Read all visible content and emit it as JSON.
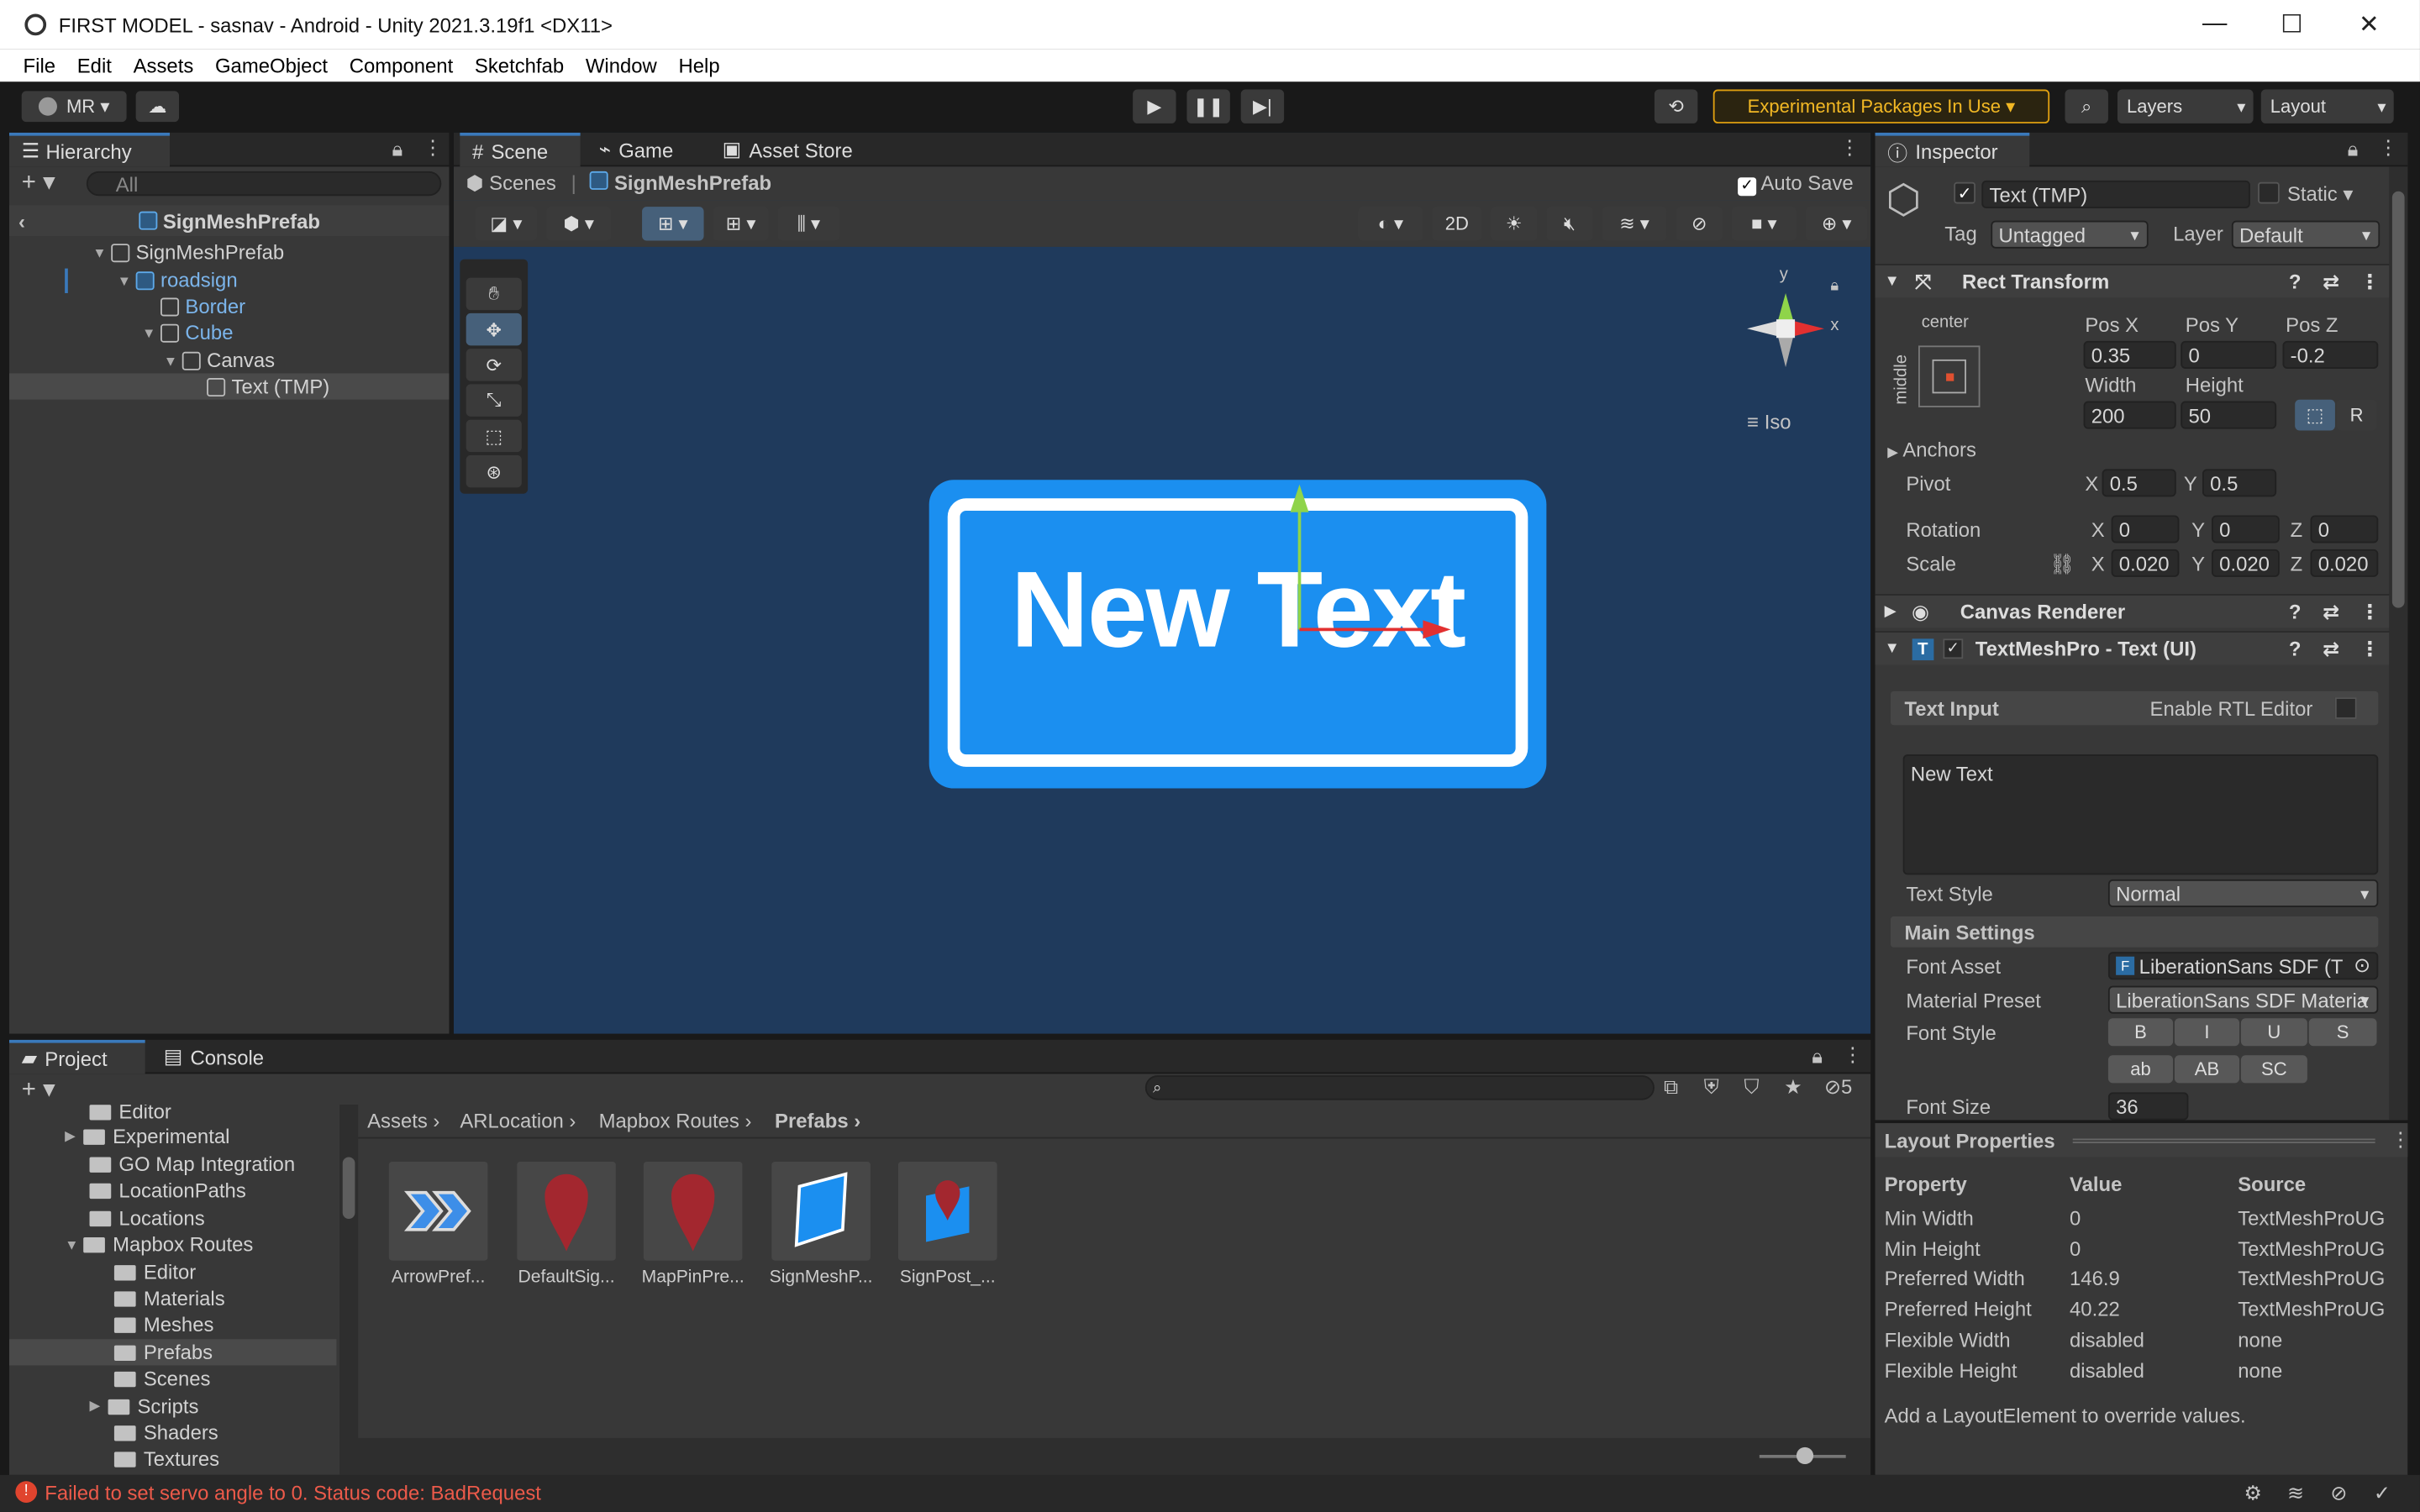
{
  "window": {
    "title": "FIRST MODEL - sasnav - Android - Unity 2021.3.19f1 <DX11>"
  },
  "menu": [
    "File",
    "Edit",
    "Assets",
    "GameObject",
    "Component",
    "Sketchfab",
    "Window",
    "Help"
  ],
  "toolbar": {
    "account": "MR",
    "experimental": "Experimental Packages In Use",
    "layers": "Layers",
    "layout": "Layout"
  },
  "hierarchy": {
    "tab": "Hierarchy",
    "search_placeholder": "All",
    "root": "SignMeshPrefab",
    "items": [
      "SignMeshPrefab",
      "roadsign",
      "Border",
      "Cube",
      "Canvas",
      "Text (TMP)"
    ]
  },
  "scene": {
    "tabs": [
      "Scene",
      "Game",
      "Asset Store"
    ],
    "breadcrumb": [
      "Scenes",
      "SignMeshPrefab"
    ],
    "auto_save": "Auto Save",
    "mode_2d": "2D",
    "iso": "Iso",
    "gizmo_y": "y",
    "gizmo_x": "x",
    "sign_text": "New Text"
  },
  "project": {
    "tabs": [
      "Project",
      "Console"
    ],
    "badge": "5",
    "folders": [
      "Editor",
      "Experimental",
      "GO Map Integration",
      "LocationPaths",
      "Locations",
      "Mapbox Routes",
      "Editor",
      "Materials",
      "Meshes",
      "Prefabs",
      "Scenes",
      "Scripts",
      "Shaders",
      "Textures"
    ],
    "path": [
      "Assets",
      "ARLocation",
      "Mapbox Routes",
      "Prefabs"
    ],
    "assets": [
      "ArrowPref...",
      "DefaultSig...",
      "MapPinPre...",
      "SignMeshP...",
      "SignPost_..."
    ]
  },
  "inspector": {
    "tab": "Inspector",
    "object_name": "Text (TMP)",
    "static_label": "Static",
    "tag_label": "Tag",
    "tag": "Untagged",
    "layer_label": "Layer",
    "layer": "Default",
    "rect": {
      "title": "Rect Transform",
      "anchor_h": "center",
      "anchor_v": "middle",
      "posx_l": "Pos X",
      "posy_l": "Pos Y",
      "posz_l": "Pos Z",
      "posx": "0.35",
      "posy": "0",
      "posz": "-0.2",
      "w_l": "Width",
      "h_l": "Height",
      "w": "200",
      "h": "50",
      "r": "R",
      "anchors": "Anchors",
      "pivot": "Pivot",
      "px": "0.5",
      "py": "0.5",
      "rotation": "Rotation",
      "rx": "0",
      "ry": "0",
      "rz": "0",
      "scale": "Scale",
      "sx": "0.020",
      "sy": "0.020",
      "sz": "0.020",
      "X": "X",
      "Y": "Y",
      "Z": "Z"
    },
    "canvas_renderer": "Canvas Renderer",
    "tmp": {
      "title": "TextMeshPro - Text (UI)",
      "text_input": "Text Input",
      "rtl": "Enable RTL Editor",
      "text": "New Text",
      "style_label": "Text Style",
      "style": "Normal",
      "main_settings": "Main Settings",
      "font_asset_l": "Font Asset",
      "font_asset": "LiberationSans SDF (T",
      "material_l": "Material Preset",
      "material": "LiberationSans SDF Materia",
      "font_style_l": "Font Style",
      "styles": [
        "B",
        "I",
        "U",
        "S",
        "ab",
        "AB",
        "SC"
      ],
      "font_size_l": "Font Size",
      "font_size": "36"
    }
  },
  "layout_props": {
    "title": "Layout Properties",
    "headers": [
      "Property",
      "Value",
      "Source"
    ],
    "rows": [
      [
        "Min Width",
        "0",
        "TextMeshProUG"
      ],
      [
        "Min Height",
        "0",
        "TextMeshProUG"
      ],
      [
        "Preferred Width",
        "146.9",
        "TextMeshProUG"
      ],
      [
        "Preferred Height",
        "40.22",
        "TextMeshProUG"
      ],
      [
        "Flexible Width",
        "disabled",
        "none"
      ],
      [
        "Flexible Height",
        "disabled",
        "none"
      ]
    ],
    "footer": "Add a LayoutElement to override values."
  },
  "status": {
    "message": "Failed to set servo angle to 0. Status code: BadRequest"
  }
}
